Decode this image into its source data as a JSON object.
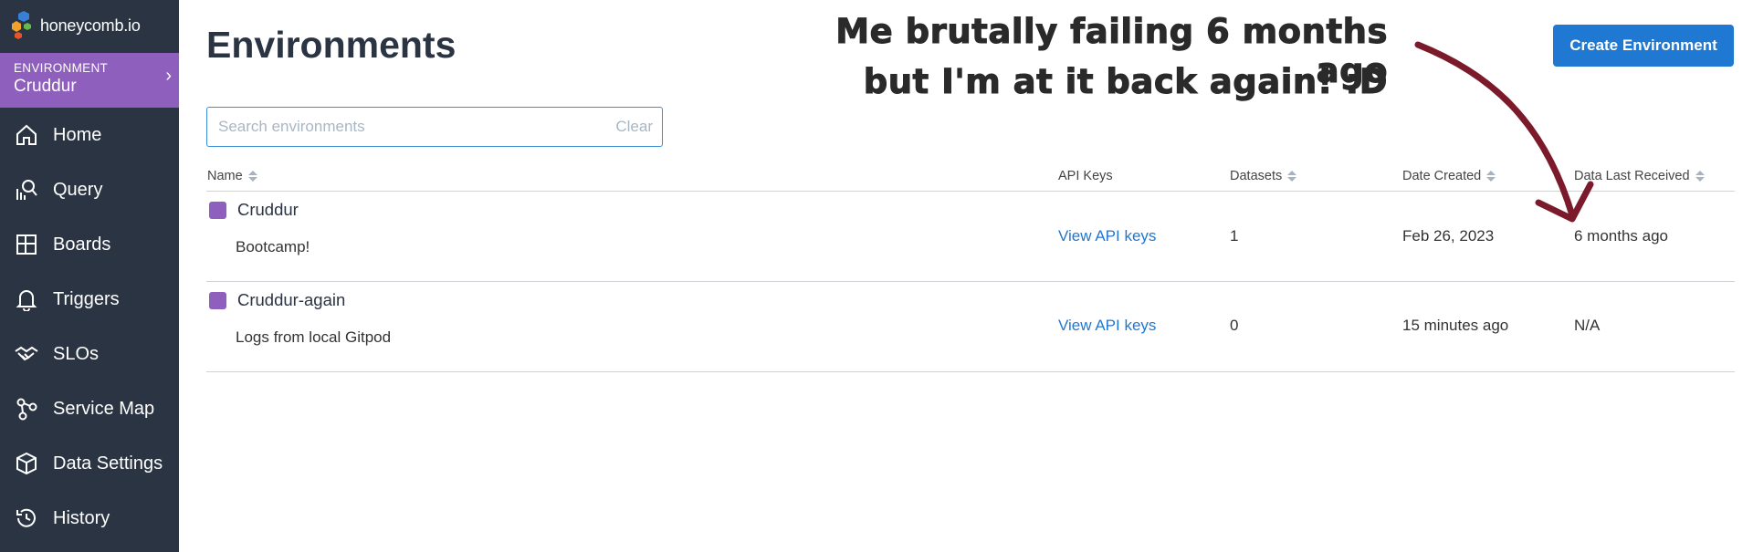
{
  "logo": {
    "text": "honeycomb.io"
  },
  "environment": {
    "label": "ENVIRONMENT",
    "name": "Cruddur",
    "chevron": "›"
  },
  "nav": [
    {
      "label": "Home",
      "icon": "home-icon"
    },
    {
      "label": "Query",
      "icon": "query-icon"
    },
    {
      "label": "Boards",
      "icon": "boards-icon"
    },
    {
      "label": "Triggers",
      "icon": "bell-icon"
    },
    {
      "label": "SLOs",
      "icon": "handshake-icon"
    },
    {
      "label": "Service Map",
      "icon": "service-map-icon"
    },
    {
      "label": "Data Settings",
      "icon": "cube-icon"
    },
    {
      "label": "History",
      "icon": "history-icon"
    }
  ],
  "page": {
    "title": "Environments",
    "create_button": "Create Environment"
  },
  "search": {
    "placeholder": "Search environments",
    "value": "",
    "clear_label": "Clear"
  },
  "table": {
    "columns": [
      "Name",
      "API Keys",
      "Datasets",
      "Date Created",
      "Data Last Received"
    ],
    "rows": [
      {
        "name": "Cruddur",
        "description": "Bootcamp!",
        "api_keys": "View API keys",
        "datasets": "1",
        "date_created": "Feb 26, 2023",
        "last_received": "6 months ago"
      },
      {
        "name": "Cruddur-again",
        "description": "Logs from local Gitpod",
        "api_keys": "View API keys",
        "datasets": "0",
        "date_created": "15 minutes ago",
        "last_received": "N/A"
      }
    ]
  },
  "annotation": {
    "line1": "Me brutally failing 6 months ago",
    "line2": "but I'm at it back again! :D"
  },
  "colors": {
    "sidebar": "#2b3442",
    "environment": "#8e5fbd",
    "accent": "#1f78d1",
    "arrow": "#7b1a2a"
  }
}
